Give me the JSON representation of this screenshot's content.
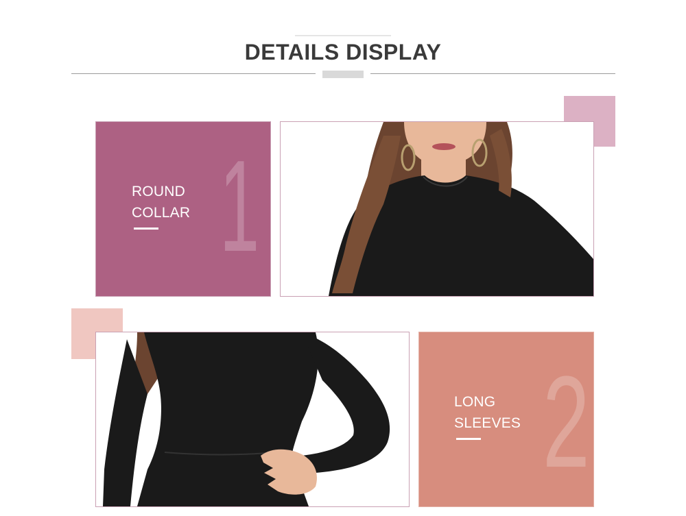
{
  "header": {
    "title": "DETAILS DISPLAY"
  },
  "details": [
    {
      "number": "1",
      "label_line1": "ROUND",
      "label_line2": "COLLAR",
      "panel_color": "#ad6183",
      "accent_square_color": "#dcb1c4"
    },
    {
      "number": "2",
      "label_line1": "LONG",
      "label_line2": "SLEEVES",
      "panel_color": "#d78d7e",
      "accent_square_color": "#f0c7c1"
    }
  ],
  "colors": {
    "title": "#3a3a3a",
    "garment": "#1a1a1a",
    "hair": "#6b4430",
    "skin": "#e8b89a"
  }
}
